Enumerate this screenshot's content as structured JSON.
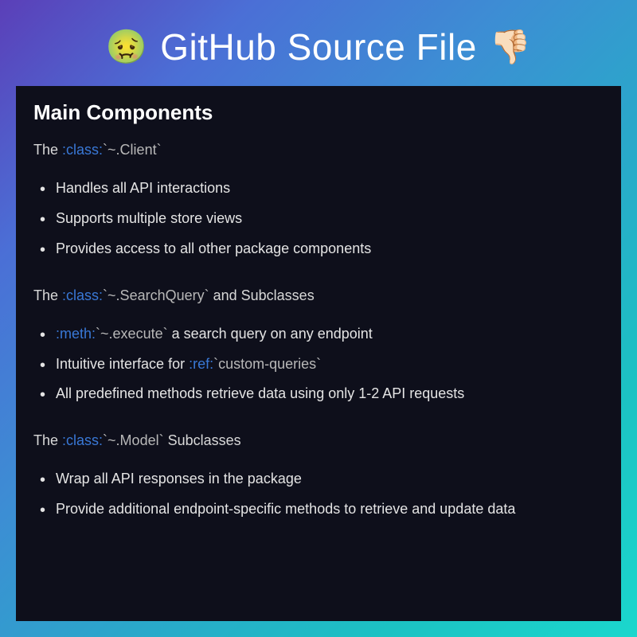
{
  "title": {
    "emoji_left": "🤢",
    "text": "GitHub Source File",
    "emoji_right": "👎🏻"
  },
  "heading": "Main Components",
  "sections": [
    {
      "intro_prefix": "The ",
      "intro_role": ":class:",
      "intro_ref": "~.Client",
      "intro_suffix": "",
      "bullets": [
        {
          "text": "Handles all API interactions"
        },
        {
          "text": "Supports multiple store views"
        },
        {
          "text": "Provides access to all other package components"
        }
      ]
    },
    {
      "intro_prefix": "The ",
      "intro_role": ":class:",
      "intro_ref": "~.SearchQuery",
      "intro_suffix": " and Subclasses",
      "bullets": [
        {
          "role": ":meth:",
          "ref": "~.execute",
          "after": " a search query on any endpoint"
        },
        {
          "before": "Intuitive interface for ",
          "role": ":ref:",
          "ref": "custom-queries"
        },
        {
          "text": "All predefined methods retrieve data using only 1-2 API requests"
        }
      ]
    },
    {
      "intro_prefix": "The ",
      "intro_role": ":class:",
      "intro_ref": "~.Model",
      "intro_suffix": " Subclasses",
      "bullets": [
        {
          "text": "Wrap all API responses in the package"
        },
        {
          "text": "Provide additional endpoint-specific methods to retrieve and update data"
        }
      ]
    }
  ]
}
